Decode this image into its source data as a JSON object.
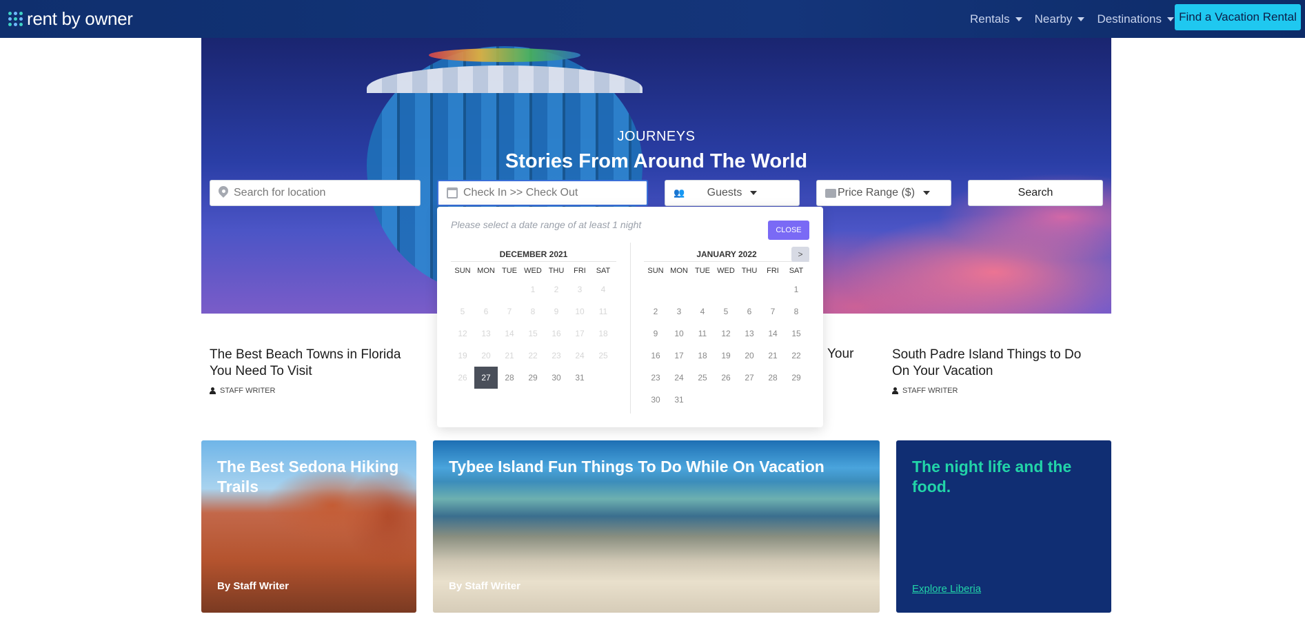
{
  "navbar": {
    "brand": "rent by owner",
    "menu": [
      {
        "label": "Rentals"
      },
      {
        "label": "Nearby"
      },
      {
        "label": "Destinations"
      }
    ],
    "cta": "Find a Vacation Rental"
  },
  "hero": {
    "eyebrow": "JOURNEYS",
    "title": "Stories From Around The World"
  },
  "search": {
    "location_placeholder": "Search for location",
    "dates_placeholder": "Check In >> Check Out",
    "guests_label": "Guests",
    "price_label": "Price Range ($)",
    "search_label": "Search"
  },
  "datepicker": {
    "hint": "Please select a date range of at least 1 night",
    "close_label": "CLOSE",
    "next_label": ">",
    "weekdays": [
      "SUN",
      "MON",
      "TUE",
      "WED",
      "THU",
      "FRI",
      "SAT"
    ],
    "left_month": {
      "title": "DECEMBER 2021",
      "leading_blanks": 3,
      "days": 31,
      "disabled_before": 27,
      "selected": 27
    },
    "right_month": {
      "title": "JANUARY 2022",
      "leading_blanks": 6,
      "days": 31
    }
  },
  "articles": [
    {
      "title": "The Best Beach Towns in Florida You Need To Visit",
      "author": "STAFF WRITER"
    },
    {
      "title": "South Padre Island Things to Do On Your Vacation",
      "author": "STAFF WRITER"
    }
  ],
  "partial_article_text": "Your",
  "cards": [
    {
      "title": "The Best Sedona Hiking Trails",
      "byline": "By Staff Writer"
    },
    {
      "title": "Tybee Island Fun Things To Do While On Vacation",
      "byline": "By Staff Writer"
    },
    {
      "title": "The night life and the food.",
      "link": "Explore Liberia"
    }
  ]
}
